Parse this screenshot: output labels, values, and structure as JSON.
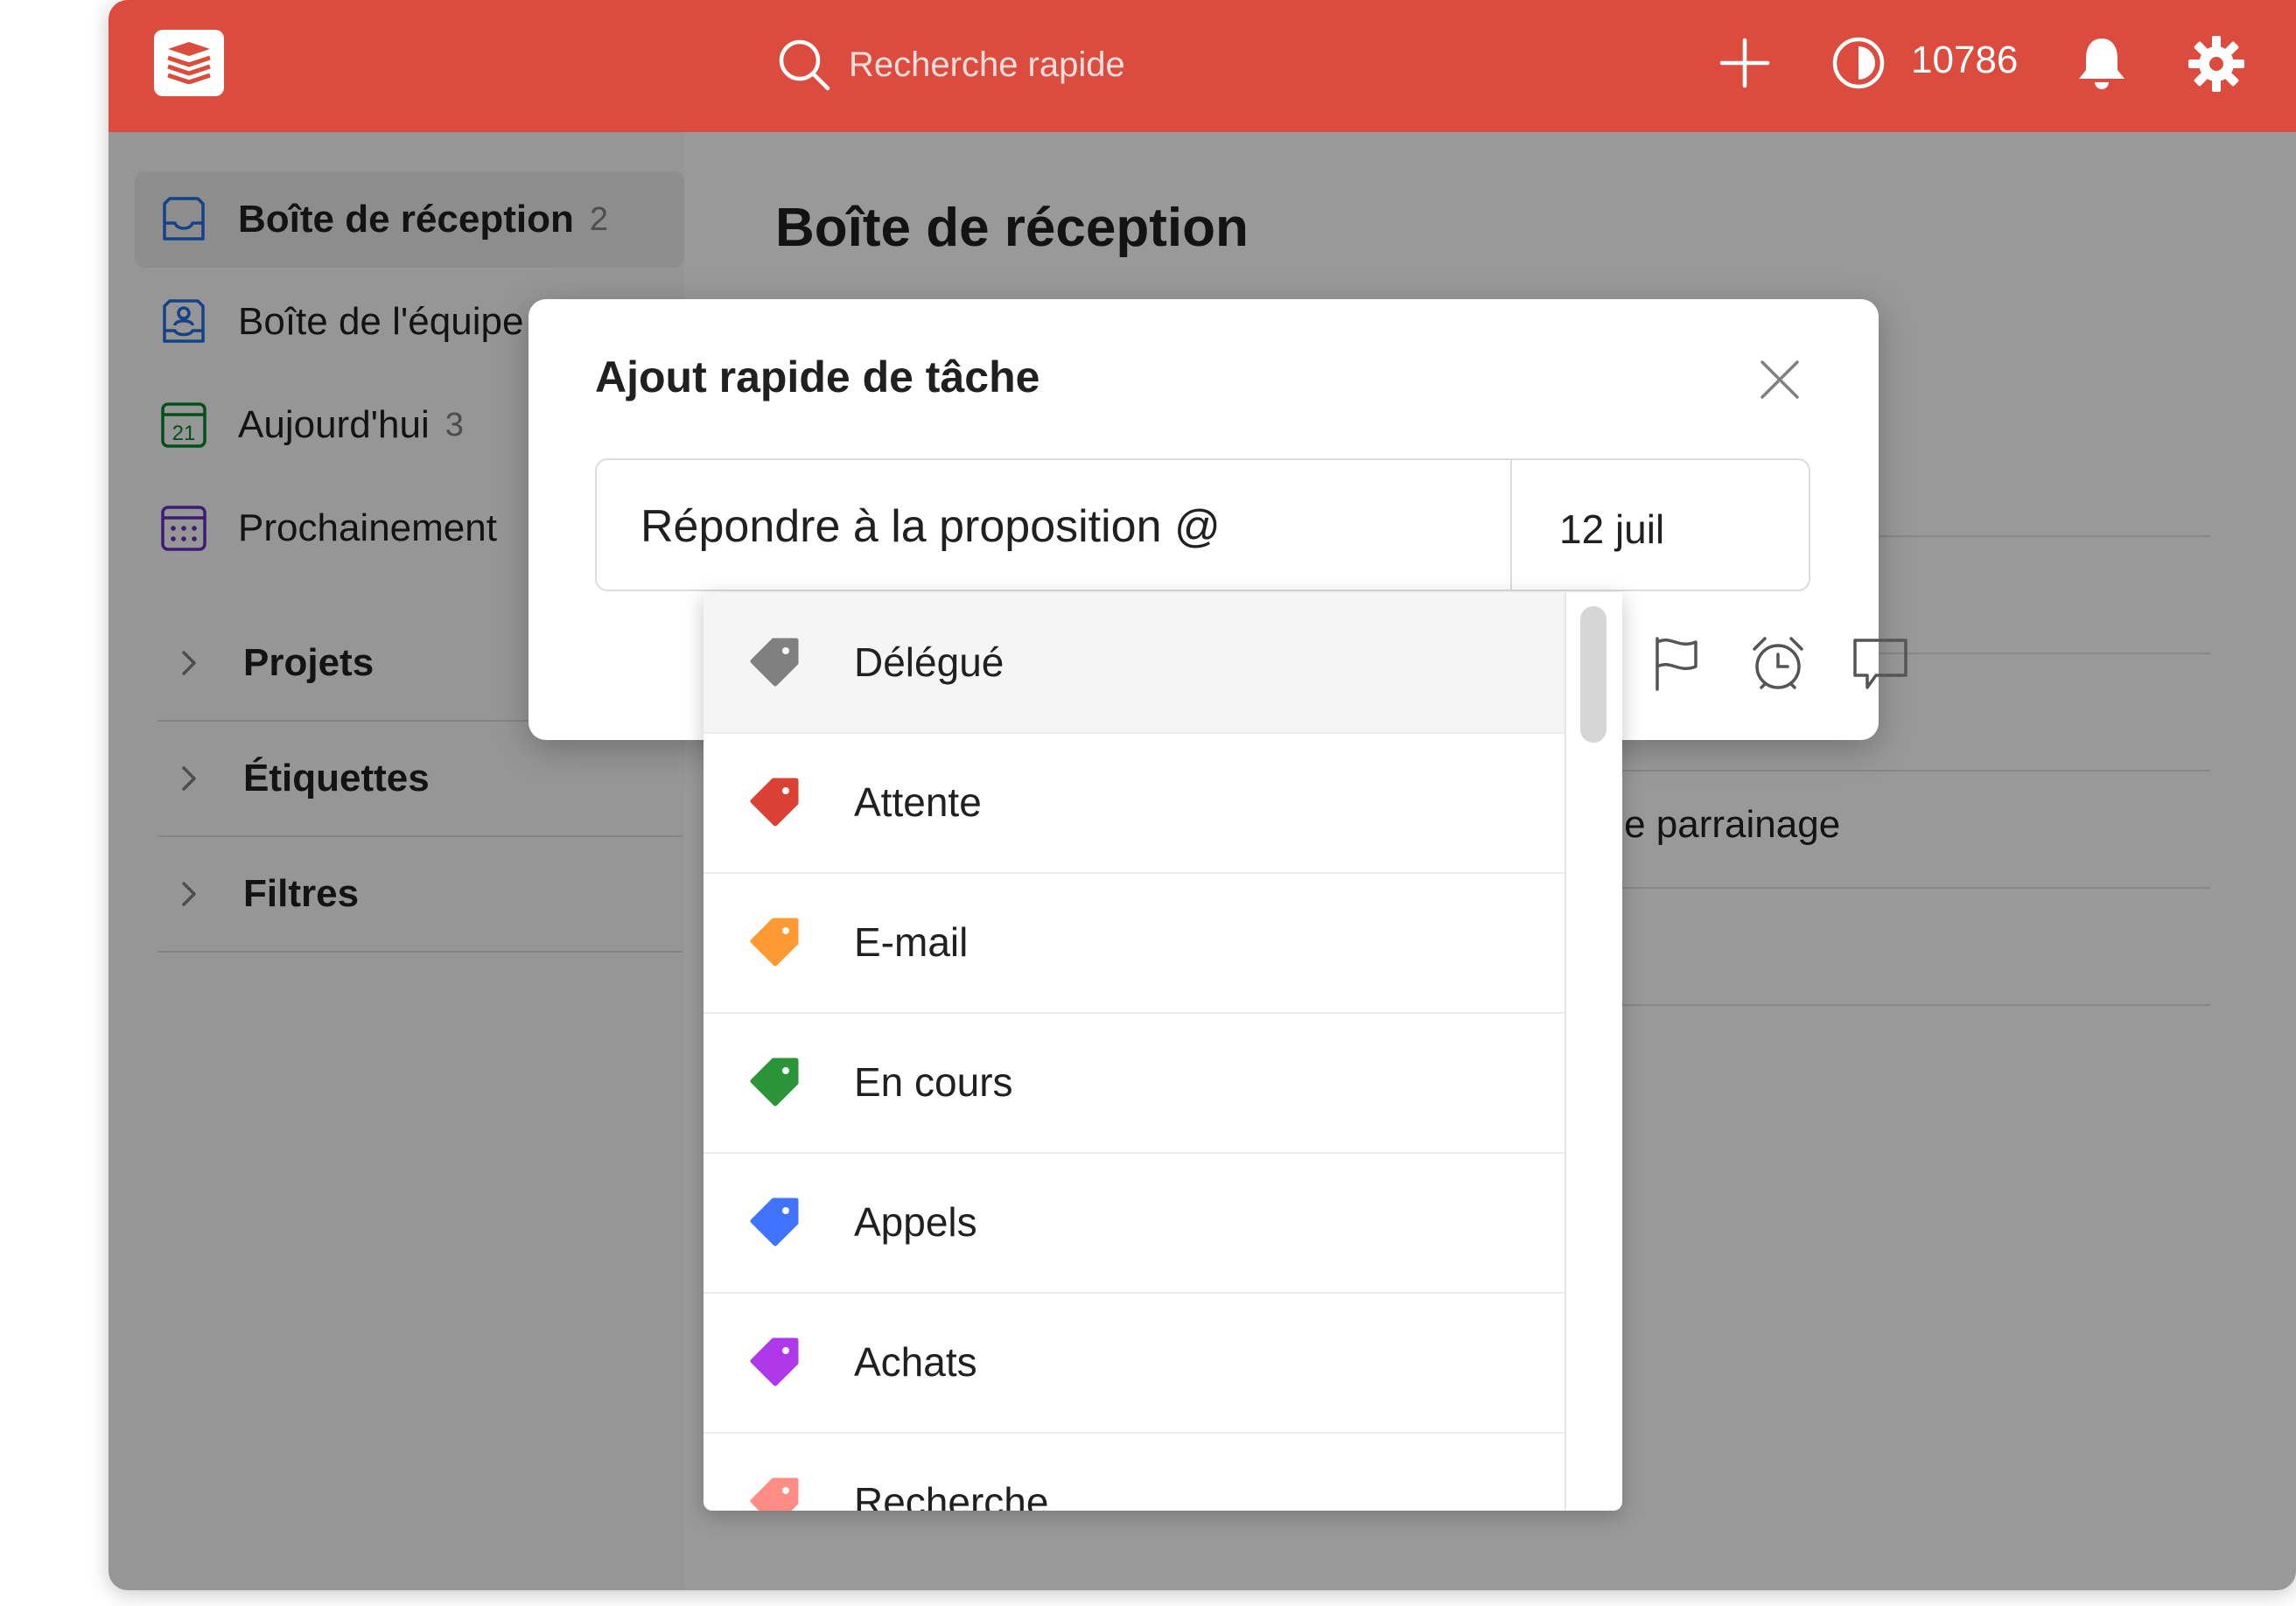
{
  "colors": {
    "brand": "#db4c3f",
    "inbox_icon": "#246fe0",
    "today_icon": "#058527",
    "upcoming_icon": "#692fc2",
    "label_default": "#808080",
    "label_attente": "#db4035",
    "label_email": "#ff9933",
    "label_en_cours": "#299438",
    "label_appels": "#4073ff",
    "label_achats": "#af38eb",
    "label_recherche": "#ff8d85"
  },
  "topbar": {
    "logo": "todoist-logo-icon",
    "search_placeholder": "Recherche rapide",
    "search_icon": "search-icon",
    "add_icon": "plus-icon",
    "karma_icon": "karma-icon",
    "karma_count": "10786",
    "notifications_icon": "bell-icon",
    "settings_icon": "gear-icon"
  },
  "sidebar": {
    "items": [
      {
        "label": "Boîte de réception",
        "count": "2",
        "icon": "inbox-icon"
      },
      {
        "label": "Boîte de l'équipe",
        "count": "",
        "icon": "team-inbox-icon"
      },
      {
        "label": "Aujourd'hui",
        "count": "3",
        "icon": "calendar-today-icon",
        "icon_text": "21"
      },
      {
        "label": "Prochainement",
        "count": "",
        "icon": "calendar-upcoming-icon"
      }
    ],
    "sections": [
      {
        "label": "Projets",
        "icon": "chevron-right-icon"
      },
      {
        "label": "Étiquettes",
        "icon": "chevron-right-icon"
      },
      {
        "label": "Filtres",
        "icon": "chevron-right-icon"
      }
    ]
  },
  "main": {
    "title": "Boîte de réception",
    "visible_task_text": "unité de parrainage"
  },
  "modal": {
    "title": "Ajout rapide de tâche",
    "close_icon": "close-icon",
    "task_input_value": "Répondre à la proposition @",
    "due_date": "12 juil",
    "tools": [
      "flag-icon",
      "alarm-icon",
      "comment-icon"
    ]
  },
  "label_dropdown": {
    "items": [
      {
        "label": "Délégué",
        "color": "#808080",
        "highlighted": true
      },
      {
        "label": "Attente",
        "color": "#db4035"
      },
      {
        "label": "E-mail",
        "color": "#ff9933"
      },
      {
        "label": "En cours",
        "color": "#299438"
      },
      {
        "label": "Appels",
        "color": "#4073ff"
      },
      {
        "label": "Achats",
        "color": "#af38eb"
      },
      {
        "label": "Recherche",
        "color": "#ff8d85"
      }
    ]
  }
}
